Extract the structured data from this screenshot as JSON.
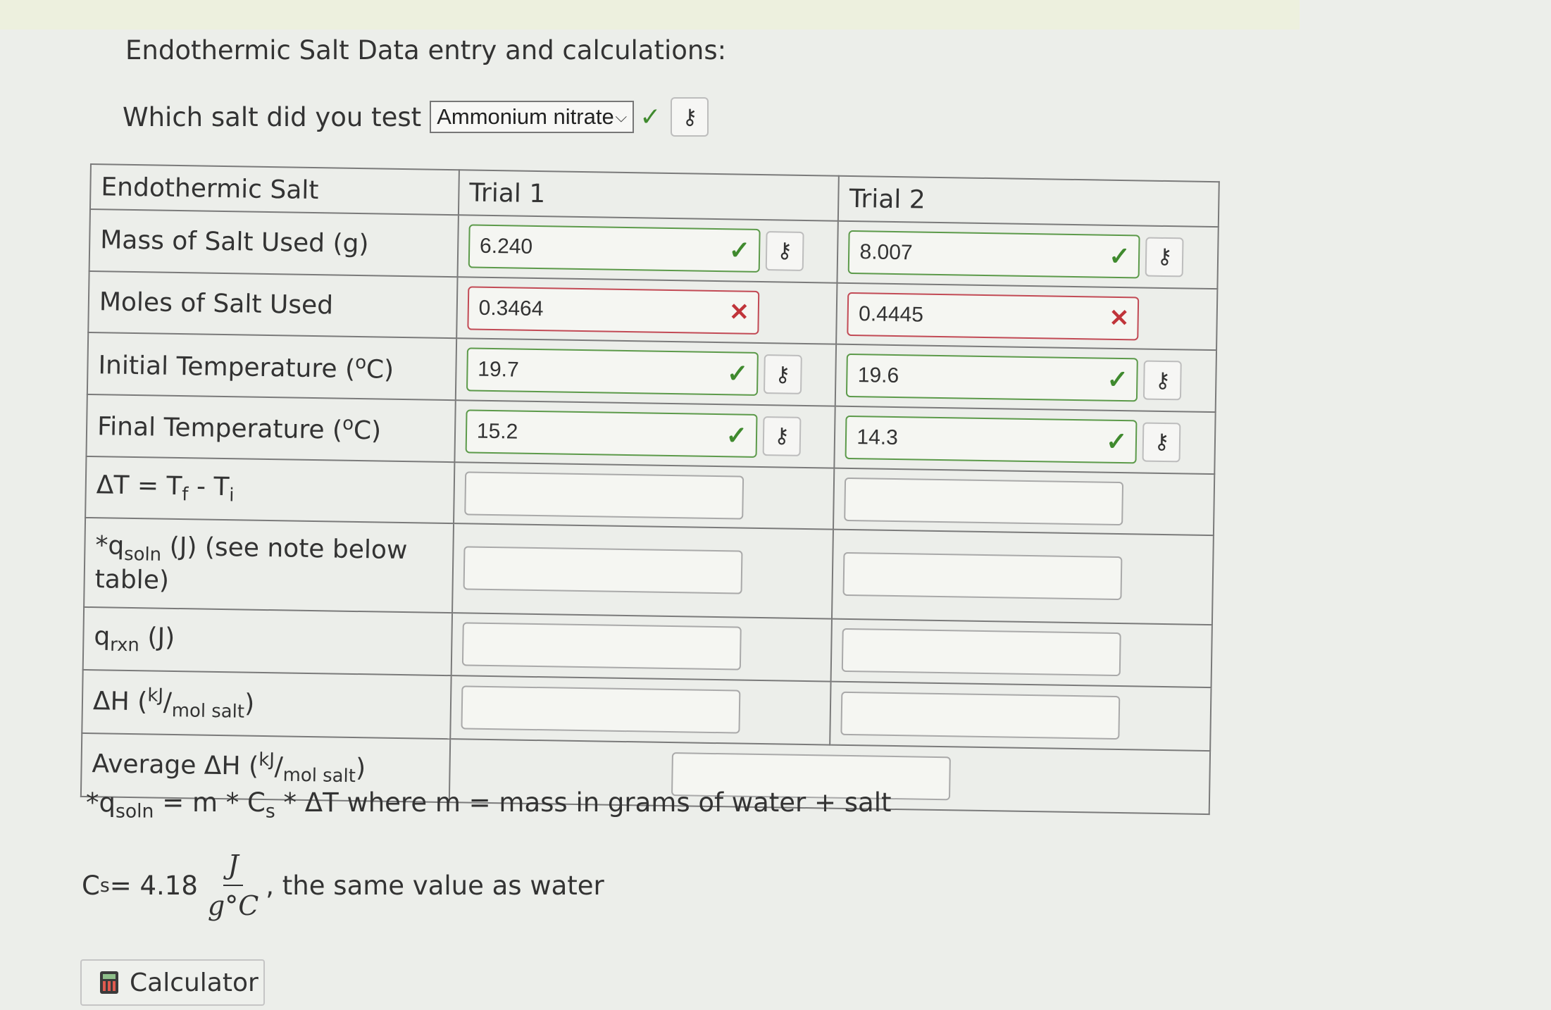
{
  "page": {
    "title": "Endothermic Salt Data entry and calculations:",
    "question": {
      "label": "Which salt did you test",
      "selected": "Ammonium nitrate"
    }
  },
  "icons": {
    "check": "✓",
    "cross": "✕",
    "key": "⚷",
    "chevron": "⌵"
  },
  "table": {
    "headers": [
      "Endothermic Salt",
      "Trial 1",
      "Trial 2"
    ],
    "rows": [
      {
        "label": "Mass of Salt Used (g)",
        "trial1": "6.240",
        "trial2": "8.007",
        "status": "correct"
      },
      {
        "label": "Moles of Salt Used",
        "trial1": "0.3464",
        "trial2": "0.4445",
        "status": "incorrect"
      },
      {
        "label_main": "Initial Temperature (",
        "label_sup": "o",
        "label_end": "C)",
        "trial1": "19.7",
        "trial2": "19.6",
        "status": "correct"
      },
      {
        "label_main": "Final Temperature (",
        "label_sup": "o",
        "label_end": "C)",
        "trial1": "15.2",
        "trial2": "14.3",
        "status": "correct"
      },
      {
        "label_a": "ΔT = T",
        "label_sub1": "f",
        "label_b": " - T",
        "label_sub2": "i"
      },
      {
        "label_star": "*q",
        "label_sub": "soln",
        "label_rest": " (J) (see note below table)"
      },
      {
        "label_q": "q",
        "label_sub": "rxn",
        "label_rest": " (J)"
      },
      {
        "label_a": "ΔH (",
        "label_sup": "kJ",
        "label_b": "/",
        "label_sub": "mol salt",
        "label_c": ")"
      },
      {
        "label_a": "Average ΔH (",
        "label_sup": "kJ",
        "label_b": "/",
        "label_sub": "mol salt",
        "label_c": ")"
      }
    ]
  },
  "note": {
    "a": "*q",
    "sub": "soln",
    "b": " = m * C",
    "sub2": "s",
    "c": " * ΔT  where m = mass in grams of water + salt"
  },
  "cs": {
    "a": "C",
    "sub": "s",
    "b": " = 4.18",
    "num": "J",
    "den": "g°C",
    "rest": ", the same value as water"
  },
  "calculator": {
    "label": "Calculator"
  },
  "colors": {
    "correct": "#3f8a2e",
    "incorrect": "#c0343a",
    "background": "#eceeea"
  }
}
